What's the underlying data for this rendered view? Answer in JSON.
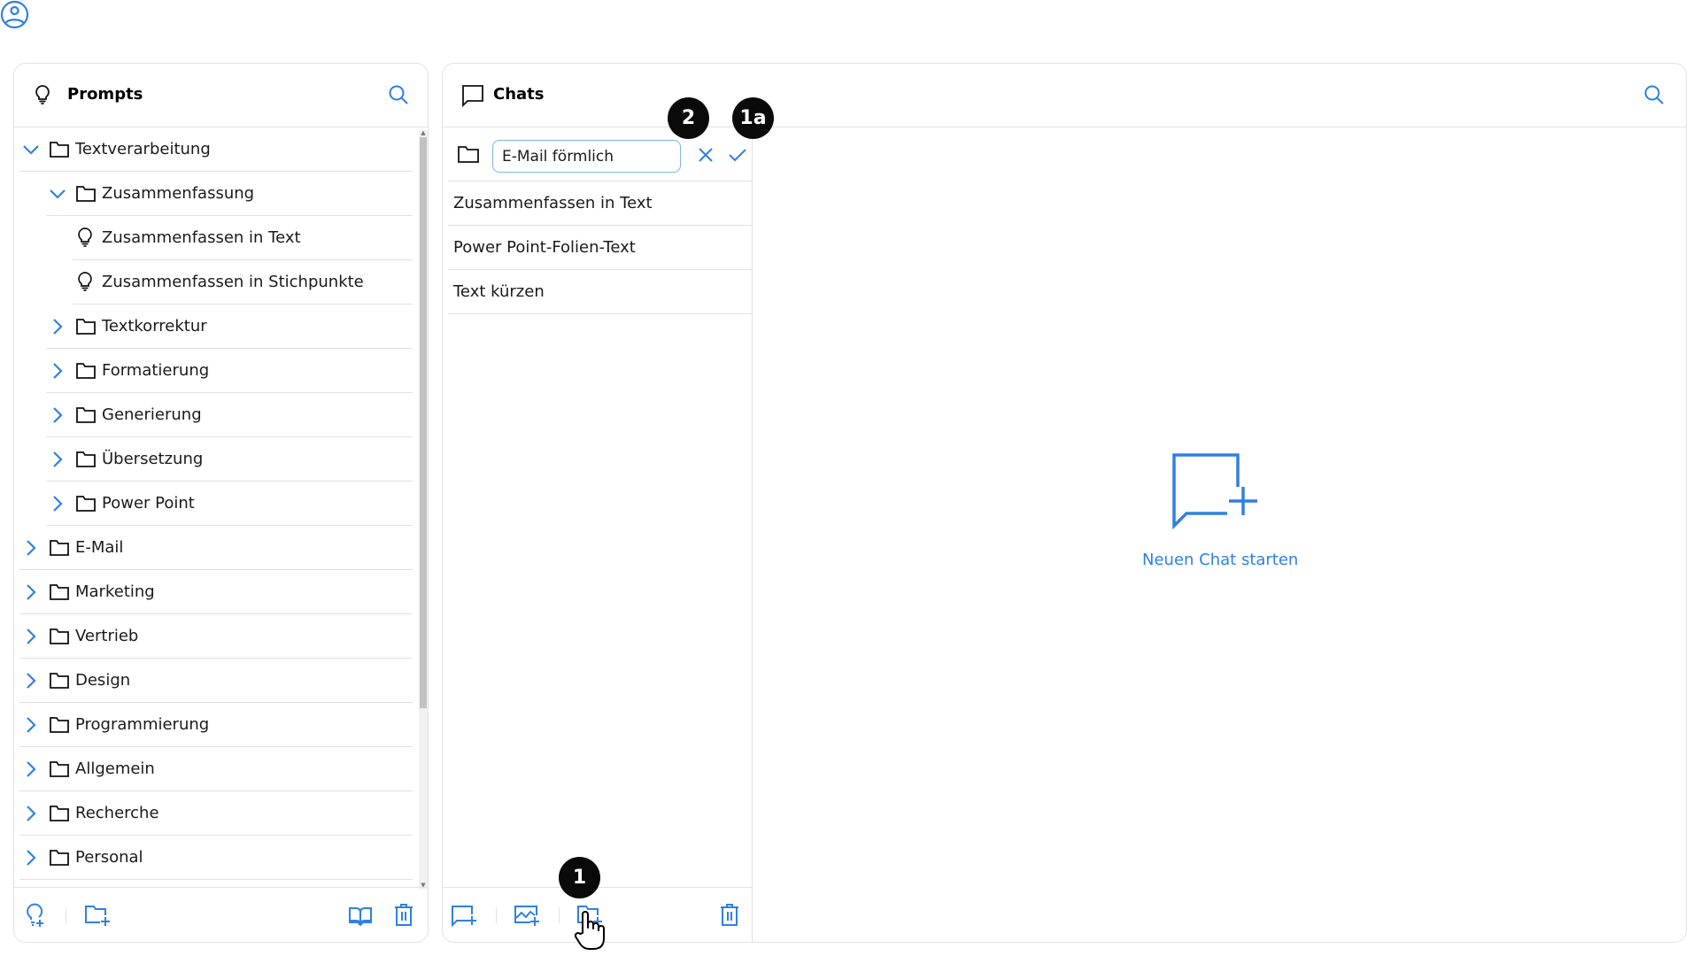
{
  "user": {
    "avatar_icon": "user-circle-icon"
  },
  "colors": {
    "accent": "#2f80e3",
    "border": "#e2e2e2",
    "badge": "#0a0a0a"
  },
  "prompts_panel": {
    "title": "Prompts",
    "header_icon": "lightbulb-icon",
    "search_icon": "search-icon",
    "tree": [
      {
        "label": "Textverarbeitung",
        "type": "folder",
        "level": 0,
        "expanded": true
      },
      {
        "label": "Zusammenfassung",
        "type": "folder",
        "level": 1,
        "expanded": true
      },
      {
        "label": "Zusammenfassen in Text",
        "type": "prompt",
        "level": 2
      },
      {
        "label": "Zusammenfassen in Stichpunkte",
        "type": "prompt",
        "level": 2
      },
      {
        "label": "Textkorrektur",
        "type": "folder",
        "level": 1,
        "expanded": false
      },
      {
        "label": "Formatierung",
        "type": "folder",
        "level": 1,
        "expanded": false
      },
      {
        "label": "Generierung",
        "type": "folder",
        "level": 1,
        "expanded": false
      },
      {
        "label": "Übersetzung",
        "type": "folder",
        "level": 1,
        "expanded": false
      },
      {
        "label": "Power Point",
        "type": "folder",
        "level": 1,
        "expanded": false
      },
      {
        "label": "E-Mail",
        "type": "folder",
        "level": 0,
        "expanded": false
      },
      {
        "label": "Marketing",
        "type": "folder",
        "level": 0,
        "expanded": false
      },
      {
        "label": "Vertrieb",
        "type": "folder",
        "level": 0,
        "expanded": false
      },
      {
        "label": "Design",
        "type": "folder",
        "level": 0,
        "expanded": false
      },
      {
        "label": "Programmierung",
        "type": "folder",
        "level": 0,
        "expanded": false
      },
      {
        "label": "Allgemein",
        "type": "folder",
        "level": 0,
        "expanded": false
      },
      {
        "label": "Recherche",
        "type": "folder",
        "level": 0,
        "expanded": false
      },
      {
        "label": "Personal",
        "type": "folder",
        "level": 0,
        "expanded": false
      }
    ],
    "footer": {
      "new_prompt_icon": "lightbulb-plus-icon",
      "new_folder_icon": "folder-plus-icon",
      "library_icon": "book-open-icon",
      "delete_icon": "trash-icon"
    }
  },
  "chats_panel": {
    "title": "Chats",
    "header_icon": "chat-bubble-icon",
    "search_icon": "search-icon",
    "new_folder": {
      "value": "E-Mail förmlich",
      "cancel_icon": "close-icon",
      "confirm_icon": "check-icon"
    },
    "items": [
      {
        "label": "Zusammenfassen in Text"
      },
      {
        "label": "Power Point-Folien-Text"
      },
      {
        "label": "Text kürzen"
      }
    ],
    "footer": {
      "new_chat_icon": "chat-plus-icon",
      "new_image_icon": "image-plus-icon",
      "new_folder_icon": "folder-plus-icon",
      "delete_icon": "trash-icon"
    },
    "empty_state": {
      "icon": "chat-plus-icon",
      "label": "Neuen Chat starten"
    }
  },
  "annotations": [
    {
      "label": "2"
    },
    {
      "label": "1a"
    },
    {
      "label": "1"
    }
  ]
}
